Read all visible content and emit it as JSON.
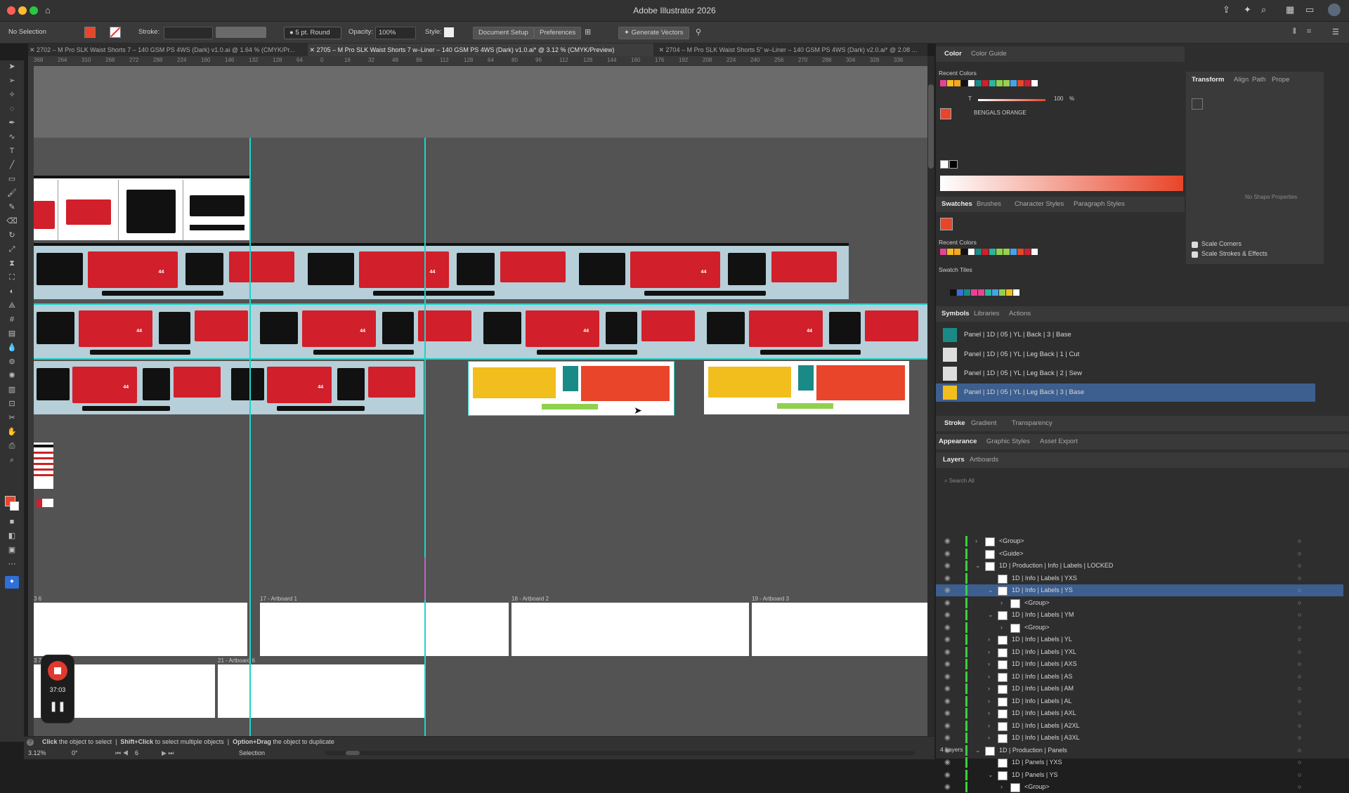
{
  "window": {
    "title": "Adobe Illustrator 2026"
  },
  "control_bar": {
    "selection": "No Selection",
    "stroke_label": "Stroke:",
    "brush": "5 pt. Round",
    "opacity_label": "Opacity:",
    "opacity_value": "100%",
    "style_label": "Style:",
    "document_setup": "Document Setup",
    "preferences": "Preferences",
    "generate_vectors": "Generate Vectors"
  },
  "tabs": [
    {
      "label": "2702 – M Pro SLK Waist Shorts 7 – 140 GSM PS 4WS (Dark) v1.0.ai @ 1.64 % (CMYK/Pr..."
    },
    {
      "label": "2705 – M Pro SLK Waist Shorts 7 w–Liner – 140 GSM PS 4WS (Dark) v1.0.ai* @ 3.12 % (CMYK/Preview)"
    },
    {
      "label": "2704 – M Pro SLK Waist Shorts 5\" w–Liner – 140 GSM PS 4WS (Dark) v2.0.ai* @ 2.08 ..."
    }
  ],
  "ruler_ticks": [
    "368",
    "264",
    "310",
    "268",
    "272",
    "288",
    "224",
    "160",
    "146",
    "132",
    "128",
    "64",
    "0",
    "16",
    "32",
    "48",
    "96",
    "112",
    "128",
    "64",
    "80",
    "96",
    "112",
    "128",
    "144",
    "160",
    "176",
    "192",
    "208",
    "224",
    "240",
    "256",
    "270",
    "288",
    "304",
    "328",
    "336"
  ],
  "artboards": {
    "a17": "17 - Artboard 1",
    "a18": "18 - Artboard 2",
    "a19": "19 - Artboard 3",
    "a21": "21 - Artboard 6",
    "a16": "3 6",
    "a20": "3 7"
  },
  "product_numbers": {
    "n44": "44"
  },
  "recorder": {
    "time": "37:03"
  },
  "status": {
    "hint_1": "Click",
    "hint_1_rest": "the object to select",
    "hint_2": "Shift+Click",
    "hint_2_rest": "to select multiple objects",
    "hint_3": "Option+Drag",
    "hint_3_rest": "the object to duplicate",
    "zoom": "3.12%",
    "rotation": "0°",
    "artboard_num": "6",
    "tool": "Selection"
  },
  "color_panel": {
    "tabs": [
      "Color",
      "Color Guide"
    ],
    "recent_label": "Recent Colors",
    "tint_value": "100",
    "tint_unit": "%",
    "tint_t": "T",
    "swatch_name": "BENGALS ORANGE"
  },
  "transform_panel": {
    "tabs": [
      "Transform",
      "Align",
      "Path",
      "Prope"
    ],
    "no_shape": "No Shape Properties",
    "scale_corners": "Scale Corners",
    "scale_strokes": "Scale Strokes & Effects"
  },
  "swatches_panel": {
    "tabs": [
      "Swatches",
      "Brushes",
      "Character Styles",
      "Paragraph Styles"
    ],
    "recent_label": "Recent Colors",
    "tiles_label": "Swatch Tiles"
  },
  "symbols_panel": {
    "tabs": [
      "Symbols",
      "Libraries",
      "Actions"
    ],
    "items": [
      {
        "label": "Panel | 1D | 05 | YL | Back | 3 | Base"
      },
      {
        "label": "Panel | 1D | 05 | YL | Leg Back | 1 | Cut"
      },
      {
        "label": "Panel | 1D | 05 | YL | Leg Back | 2 | Sew"
      },
      {
        "label": "Panel | 1D | 05 | YL | Leg Back | 3 | Base"
      }
    ]
  },
  "stroke_tabs": [
    "Stroke",
    "Gradient",
    "Transparency"
  ],
  "appearance_tabs": [
    "Appearance",
    "Graphic Styles",
    "Asset Export"
  ],
  "layers_panel": {
    "tabs": [
      "Layers",
      "Artboards"
    ],
    "search_placeholder": "Search All",
    "footer": "4 Layers",
    "rows": [
      {
        "label": "<Group>"
      },
      {
        "label": "<Guide>"
      },
      {
        "label": "1D | Production | Info | Labels | LOCKED"
      },
      {
        "label": "1D | Info | Labels | YXS"
      },
      {
        "label": "1D | Info | Labels | YS"
      },
      {
        "label": "<Group>"
      },
      {
        "label": "1D | Info | Labels | YM"
      },
      {
        "label": "<Group>"
      },
      {
        "label": "1D | Info | Labels | YL"
      },
      {
        "label": "1D | Info | Labels | YXL"
      },
      {
        "label": "1D | Info | Labels | AXS"
      },
      {
        "label": "1D | Info | Labels | AS"
      },
      {
        "label": "1D | Info | Labels | AM"
      },
      {
        "label": "1D | Info | Labels | AL"
      },
      {
        "label": "1D | Info | Labels | AXL"
      },
      {
        "label": "1D | Info | Labels | A2XL"
      },
      {
        "label": "1D | Info | Labels | A3XL"
      },
      {
        "label": "1D | Production | Panels"
      },
      {
        "label": "1D | Panels | YXS"
      },
      {
        "label": "1D | Panels | YS"
      },
      {
        "label": "<Group>"
      }
    ]
  },
  "colors": {
    "accent": "#e8452a",
    "guide": "#20d3c8",
    "selection": "#3d5f8f"
  }
}
